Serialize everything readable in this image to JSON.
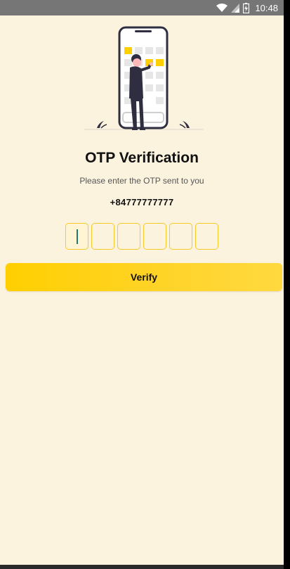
{
  "status_bar": {
    "time": "10:48"
  },
  "screen": {
    "title": "OTP Verification",
    "subtitle": "Please enter the OTP sent to you",
    "phone_number": "+84777777777"
  },
  "otp": {
    "digits": [
      "",
      "",
      "",
      "",
      "",
      ""
    ]
  },
  "buttons": {
    "verify_label": "Verify"
  },
  "colors": {
    "background": "#fcf3df",
    "accent": "#ffcf00",
    "otp_border": "#f4c928",
    "status_bar": "#767676",
    "caret": "#1e7b6e"
  },
  "icons": [
    "wifi-icon",
    "signal-icon",
    "battery-icon",
    "phone-illustration"
  ]
}
